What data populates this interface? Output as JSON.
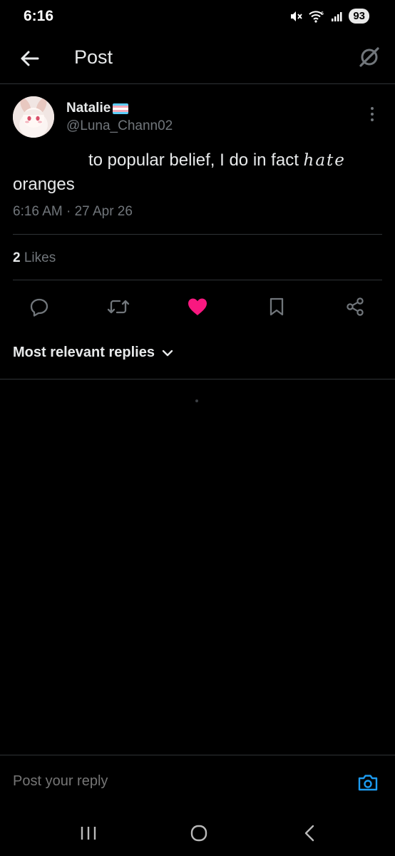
{
  "status_bar": {
    "time": "6:16",
    "battery": "93",
    "icons": [
      "mute-icon",
      "wifi-6-icon",
      "signal-icon",
      "battery-icon"
    ]
  },
  "header": {
    "title": "Post",
    "back_icon": "arrow-left-icon",
    "grok_icon": "grok-icon"
  },
  "post": {
    "display_name": "Natalie",
    "handle": "@Luna_Chann02",
    "text_main": "to popular belief, I do in fact",
    "text_handwritten": "hate",
    "text_end": "oranges",
    "timestamp": "6:16 AM · 27 Apr 26",
    "likes_count": "2",
    "likes_label": "Likes"
  },
  "actions": {
    "reply": "reply-icon",
    "repost": "repost-icon",
    "like": "heart-icon",
    "bookmark": "bookmark-icon",
    "share": "share-icon"
  },
  "replies": {
    "sort_label": "Most relevant replies"
  },
  "reply_bar": {
    "placeholder": "Post your reply"
  },
  "colors": {
    "background": "#000000",
    "text": "#e7e9ea",
    "muted": "#71767b",
    "like": "#f91880",
    "accent": "#1d9bf0",
    "divider": "#2f3336"
  }
}
